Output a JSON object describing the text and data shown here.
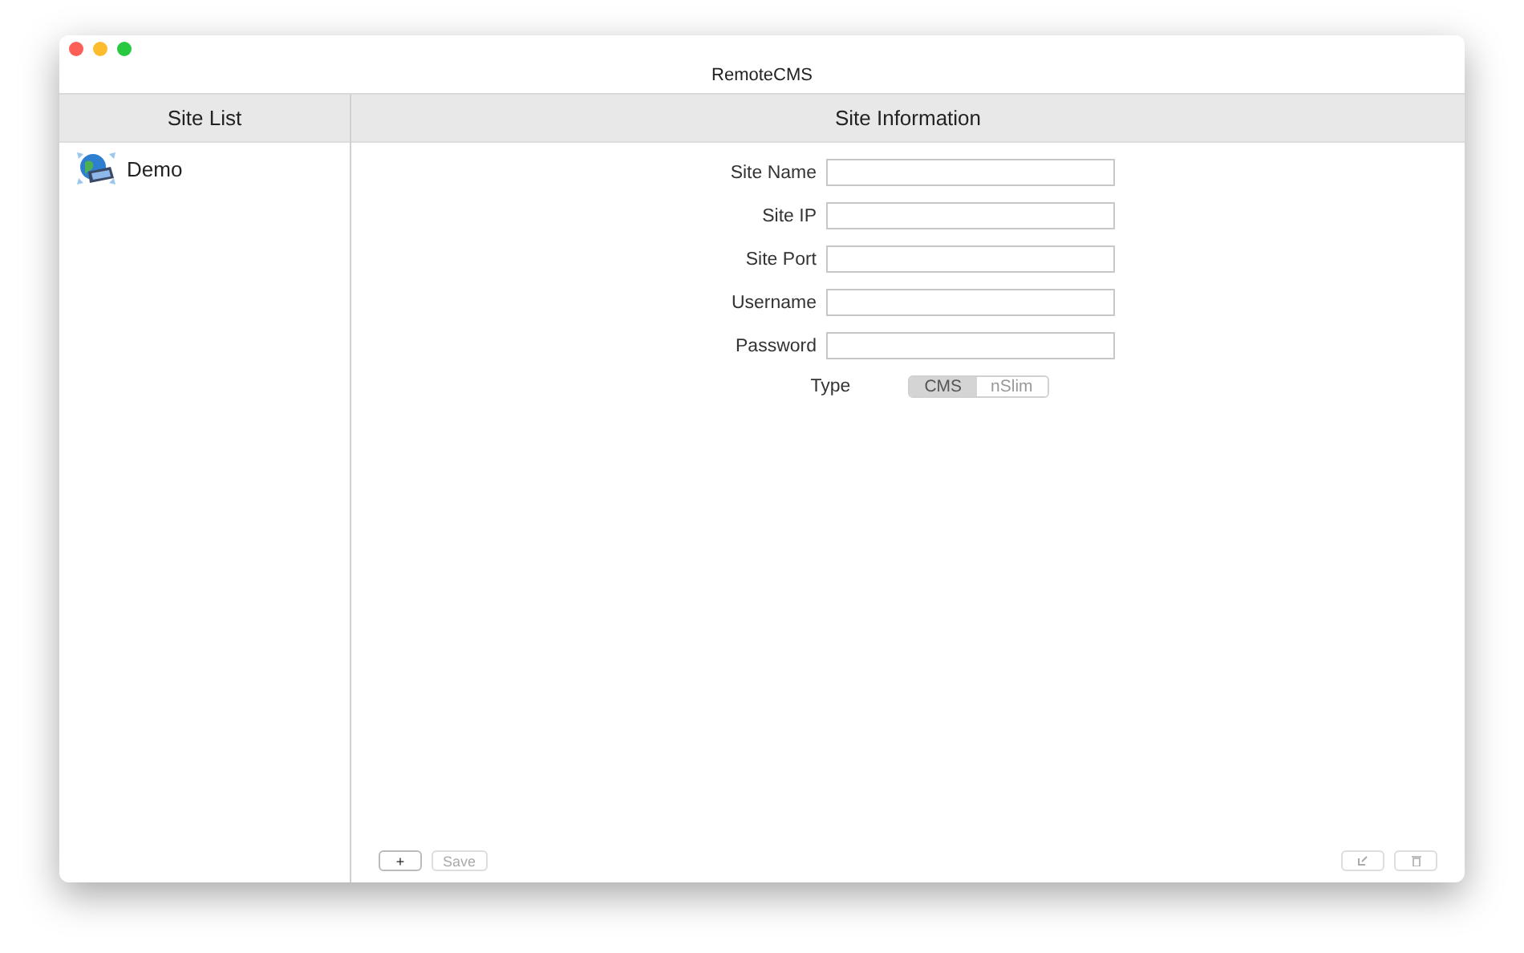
{
  "window": {
    "title": "RemoteCMS"
  },
  "sidebar": {
    "header": "Site List",
    "items": [
      {
        "label": "Demo",
        "selected": false
      }
    ]
  },
  "main": {
    "header": "Site Information",
    "fields": [
      {
        "label": "Site Name"
      },
      {
        "label": "Site IP"
      },
      {
        "label": "Site Port"
      },
      {
        "label": "Username"
      },
      {
        "label": "Password"
      }
    ],
    "type": {
      "label": "Type",
      "options": [
        {
          "label": "CMS",
          "selected": true
        },
        {
          "label": "nSlim",
          "selected": false
        }
      ]
    }
  },
  "footer_left": [
    {
      "kind": "text",
      "label": "+",
      "disabled": false
    },
    {
      "kind": "text",
      "label": "Save",
      "disabled": true
    }
  ],
  "footer_right": [
    {
      "kind": "edit",
      "disabled": true
    },
    {
      "kind": "trash",
      "disabled": true
    }
  ]
}
